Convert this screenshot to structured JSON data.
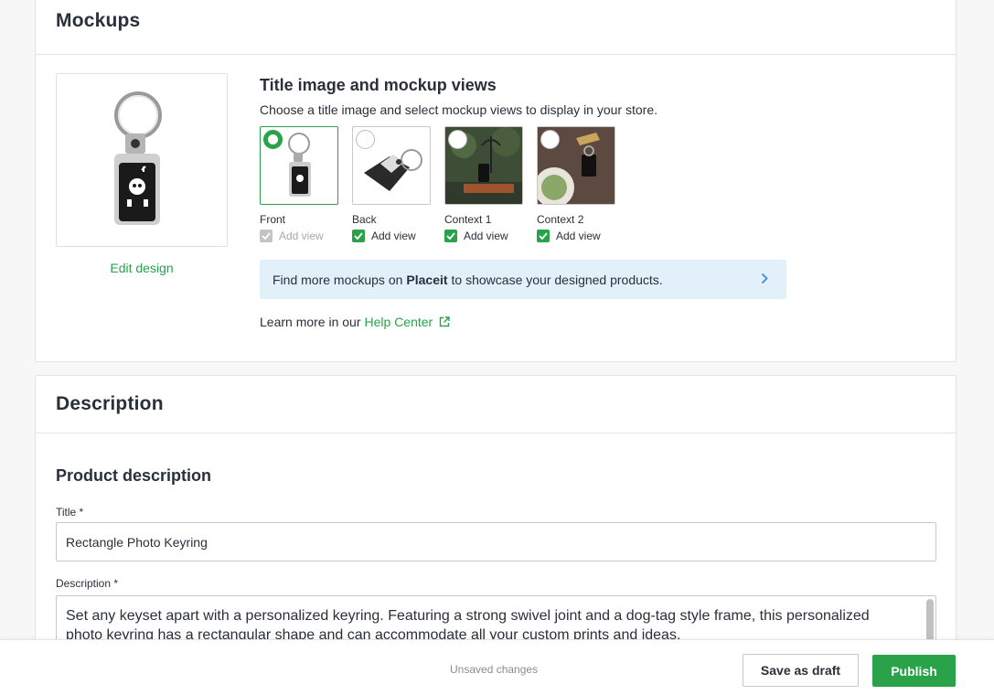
{
  "mockups": {
    "title": "Mockups",
    "edit_design": "Edit design",
    "section_title": "Title image and mockup views",
    "section_desc": "Choose a title image and select mockup views to display in your store.",
    "views": [
      {
        "label": "Front",
        "add_view": "Add view",
        "title_selected": true,
        "checked": true,
        "disabled": true
      },
      {
        "label": "Back",
        "add_view": "Add view",
        "title_selected": false,
        "checked": true,
        "disabled": false
      },
      {
        "label": "Context 1",
        "add_view": "Add view",
        "title_selected": false,
        "checked": true,
        "disabled": false
      },
      {
        "label": "Context 2",
        "add_view": "Add view",
        "title_selected": false,
        "checked": true,
        "disabled": false
      }
    ],
    "banner": {
      "prefix": "Find more mockups on",
      "brand": "Placeit",
      "suffix": "to showcase your designed products."
    },
    "help": {
      "prefix": "Learn more in our",
      "link": "Help Center"
    }
  },
  "description": {
    "title": "Description",
    "section_title": "Product description",
    "title_label": "Title *",
    "title_value": "Rectangle Photo Keyring",
    "desc_label": "Description *",
    "desc_value": "Set any keyset apart with a personalized keyring. Featuring a strong swivel joint and a dog-tag style frame, this personalized photo keyring has a rectangular shape and can accommodate all your custom prints and ideas."
  },
  "footer": {
    "status": "Unsaved changes",
    "draft_label": "Save as draft",
    "publish_label": "Publish"
  },
  "colors": {
    "accent": "#2aa24a",
    "banner_bg": "#e2f0f9",
    "text": "#29303a"
  }
}
